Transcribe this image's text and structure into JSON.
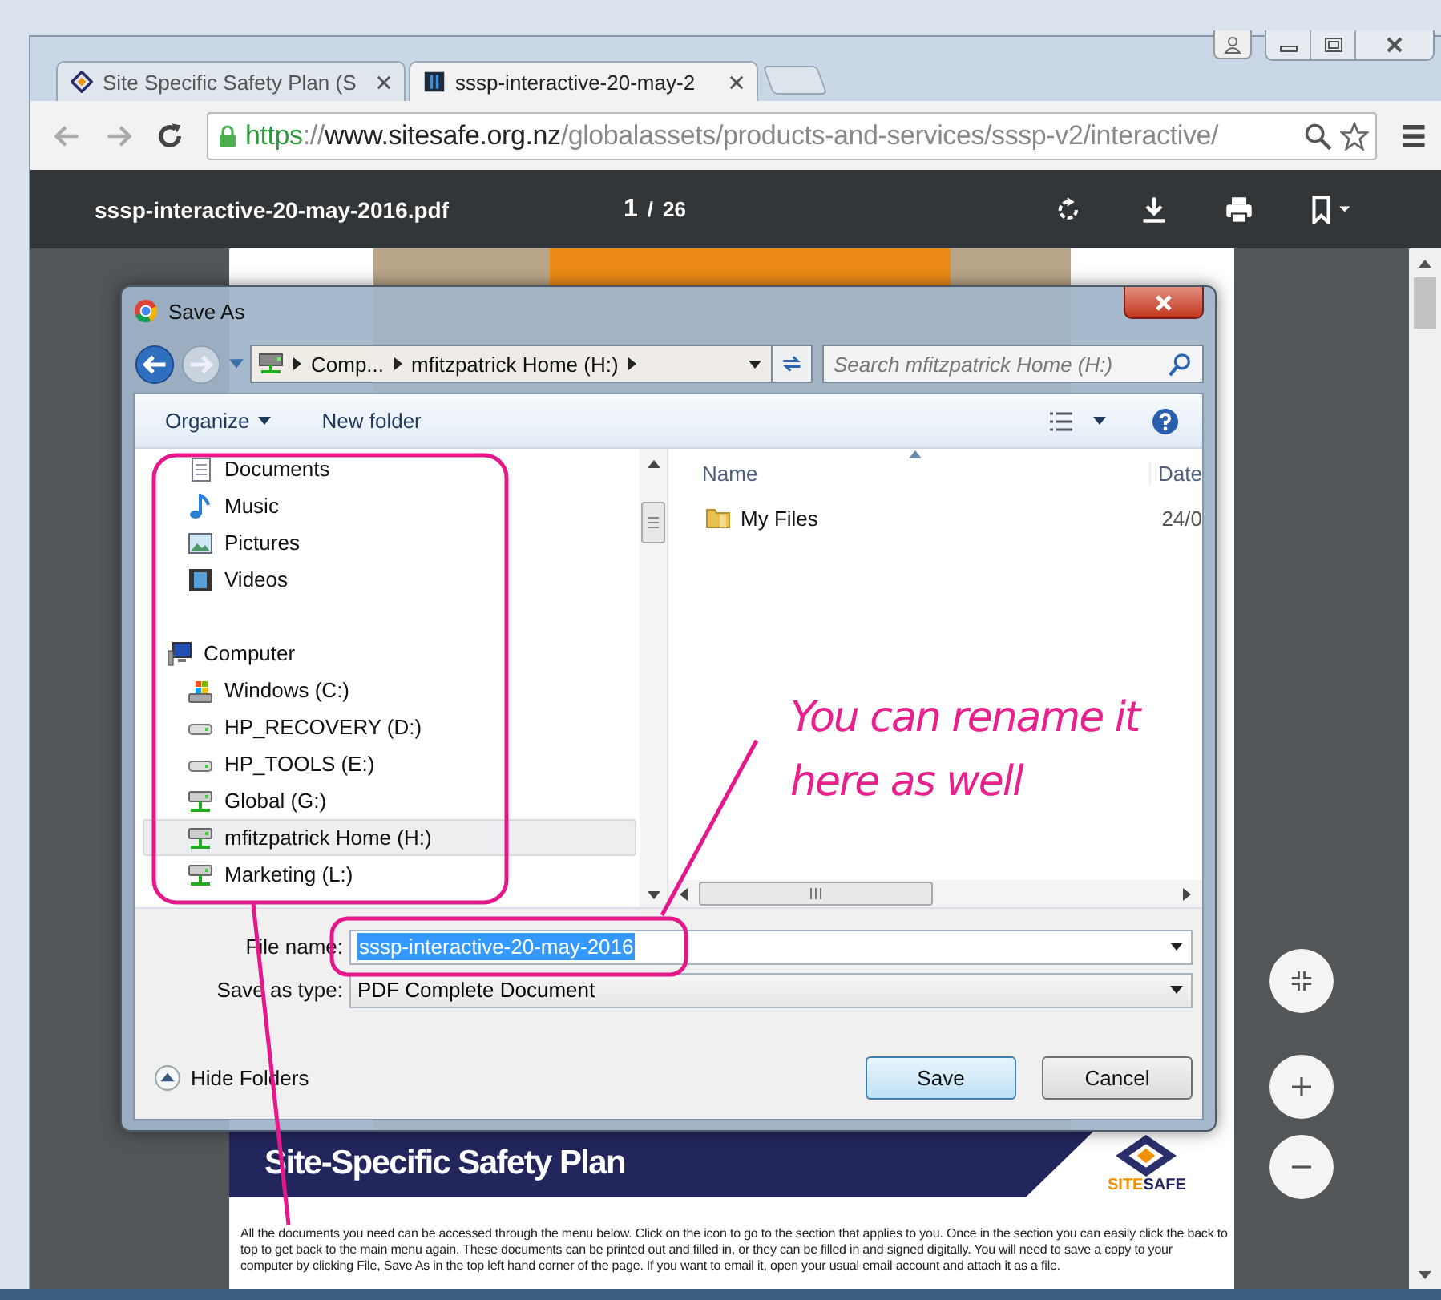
{
  "browser": {
    "tabs": [
      {
        "title": "Site Specific Safety Plan (S",
        "kind": "site",
        "selected": false
      },
      {
        "title": "sssp-interactive-20-may-2",
        "kind": "pdf",
        "selected": true
      }
    ],
    "url_parts": [
      {
        "text": "https",
        "kind": "scheme"
      },
      {
        "text": "://",
        "kind": "sep"
      },
      {
        "text": "www.sitesafe.org.nz",
        "kind": "host"
      },
      {
        "text": "/globalassets/products-and-services/sssp-v2/interactive/",
        "kind": "path"
      }
    ]
  },
  "viewer": {
    "file_name": "sssp-interactive-20-may-2016.pdf",
    "page_current": "1",
    "page_separator": "/",
    "page_total": "26"
  },
  "pdf_page": {
    "banner_title": "Site-Specific Safety Plan",
    "logo_parts": [
      "SITE",
      "SAFE"
    ],
    "intro": "All the documents you need can be accessed through the menu below. Click on the icon to go to the section that applies to you. Once in the section you can easily click the back to top to get back to the main menu again. These documents can be printed out and filled in, or they can be filled in and signed digitally.  You will need to save a copy to your computer by clicking File, Save As in the top left hand corner of the page.  If you want to email it, open your usual email account and attach it as a file."
  },
  "dialog": {
    "title": "Save As",
    "breadcrumb": [
      "Comp...",
      "mfitzpatrick Home (H:)"
    ],
    "search": {
      "placeholder": "Search mfitzpatrick Home (H:)"
    },
    "toolbar": {
      "organize": "Organize",
      "new_folder": "New folder"
    },
    "nav_tree": [
      {
        "label": "Documents",
        "kind": "documents",
        "selected": false
      },
      {
        "label": "Music",
        "kind": "music",
        "selected": false
      },
      {
        "label": "Pictures",
        "kind": "pictures",
        "selected": false
      },
      {
        "label": "Videos",
        "kind": "videos",
        "selected": false
      },
      {
        "label": "Computer",
        "kind": "computer",
        "selected": false,
        "children": [
          {
            "label": "Windows (C:)",
            "kind": "system",
            "selected": false
          },
          {
            "label": "HP_RECOVERY (D:)",
            "kind": "local",
            "selected": false
          },
          {
            "label": "HP_TOOLS (E:)",
            "kind": "local",
            "selected": false
          },
          {
            "label": "Global (G:)",
            "kind": "network",
            "selected": false
          },
          {
            "label": "mfitzpatrick Home (H:)",
            "kind": "network",
            "selected": true
          },
          {
            "label": "Marketing (L:)",
            "kind": "network",
            "selected": false
          }
        ]
      }
    ],
    "file_list": {
      "columns": [
        "Name",
        "Date"
      ],
      "rows": [
        {
          "name": "My Files",
          "date": "24/0"
        }
      ]
    },
    "file_name_label": "File name:",
    "file_name": "sssp-interactive-20-may-2016",
    "file_name_selected": true,
    "save_type_label": "Save as type:",
    "save_type": "PDF Complete Document",
    "hide_folders": "Hide Folders",
    "buttons": {
      "save": "Save",
      "cancel": "Cancel"
    }
  },
  "annotation": {
    "text": "You can rename it here as well"
  }
}
